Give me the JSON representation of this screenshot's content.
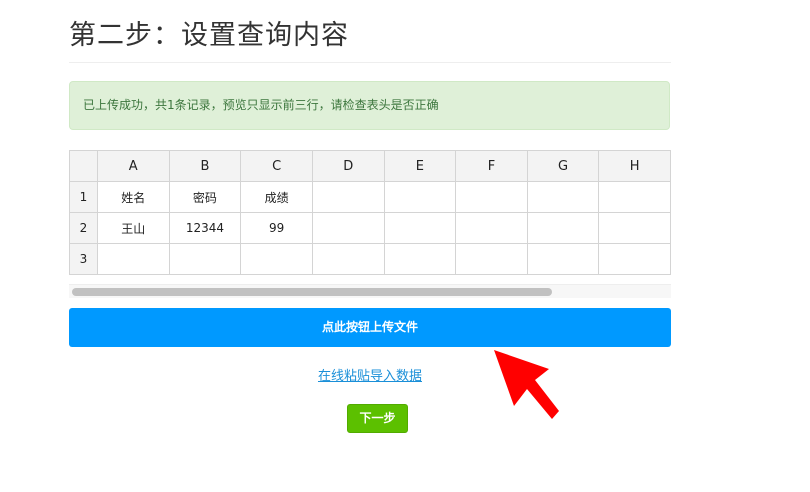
{
  "page": {
    "title": "第二步：设置查询内容"
  },
  "alert": {
    "message": "已上传成功，共1条记录，预览只显示前三行，请检查表头是否正确"
  },
  "sheet": {
    "columns": [
      "A",
      "B",
      "C",
      "D",
      "E",
      "F",
      "G",
      "H"
    ],
    "rows": [
      {
        "num": "1",
        "cells": [
          "姓名",
          "密码",
          "成绩",
          "",
          "",
          "",
          "",
          ""
        ]
      },
      {
        "num": "2",
        "cells": [
          "王山",
          "12344",
          "99",
          "",
          "",
          "",
          "",
          ""
        ]
      },
      {
        "num": "3",
        "cells": [
          "",
          "",
          "",
          "",
          "",
          "",
          "",
          ""
        ]
      }
    ]
  },
  "actions": {
    "upload_label": "点此按钮上传文件",
    "paste_link": "在线粘贴导入数据",
    "next_label": "下一步"
  },
  "colors": {
    "primary": "#0099ff",
    "success": "#5cc000",
    "alert_bg": "#dff0d8",
    "alert_text": "#3c763d",
    "annotation_arrow": "#ff0000"
  }
}
